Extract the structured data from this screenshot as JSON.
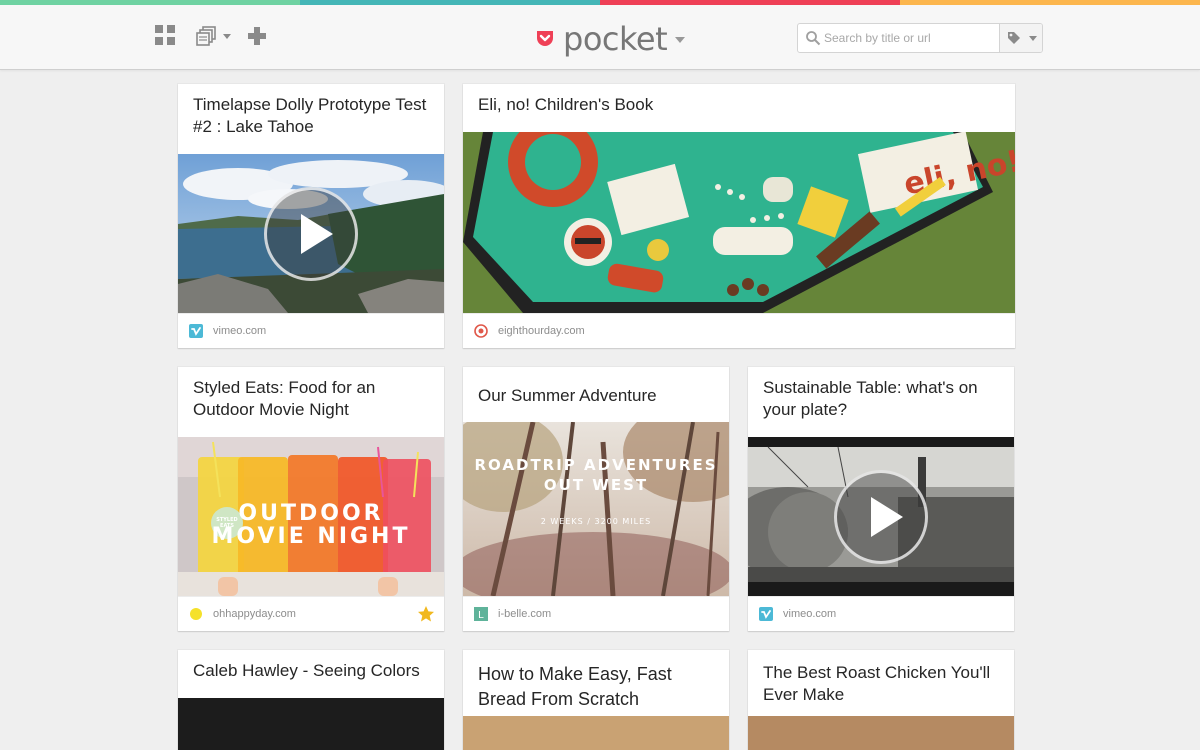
{
  "app": {
    "name": "pocket"
  },
  "colors": {
    "strip": [
      "#6fd2a2",
      "#44b6b7",
      "#ef4056",
      "#fcb64e"
    ],
    "brand": "#ef4056",
    "vimeo": "#4cb9d6"
  },
  "toolbar": {
    "grid_icon": "grid-view-icon",
    "list_icon": "stacked-pages-icon",
    "add_icon": "plus-icon"
  },
  "search": {
    "placeholder": "Search by title or url",
    "value": ""
  },
  "tag_filter": {
    "icon": "tag-icon"
  },
  "items": [
    {
      "title": "Timelapse Dolly Prototype Test #2 : Lake Tahoe",
      "domain": "vimeo.com",
      "video": true,
      "favorite": false
    },
    {
      "title": "Eli, no! Children's Book",
      "domain": "eighthourday.com",
      "video": false,
      "favorite": false
    },
    {
      "title": "Styled Eats: Food for an Outdoor Movie Night",
      "domain": "ohhappyday.com",
      "video": false,
      "favorite": true,
      "overlay": [
        "OUTDOOR",
        "MOVIE NIGHT"
      ],
      "badge": "STYLED EATS"
    },
    {
      "title": "Our Summer Adventure",
      "domain": "i-belle.com",
      "video": false,
      "favorite": false,
      "overlay": [
        "ROADTRIP ADVENTURES",
        "OUT WEST"
      ],
      "subline": "2 WEEKS / 3200 MILES"
    },
    {
      "title": "Sustainable Table: what's on your plate?",
      "domain": "vimeo.com",
      "video": true,
      "favorite": false
    },
    {
      "title": "Caleb Hawley - Seeing Colors"
    },
    {
      "title": "How to Make Easy, Fast Bread From Scratch"
    },
    {
      "title": "The Best Roast Chicken You'll Ever Make"
    }
  ]
}
